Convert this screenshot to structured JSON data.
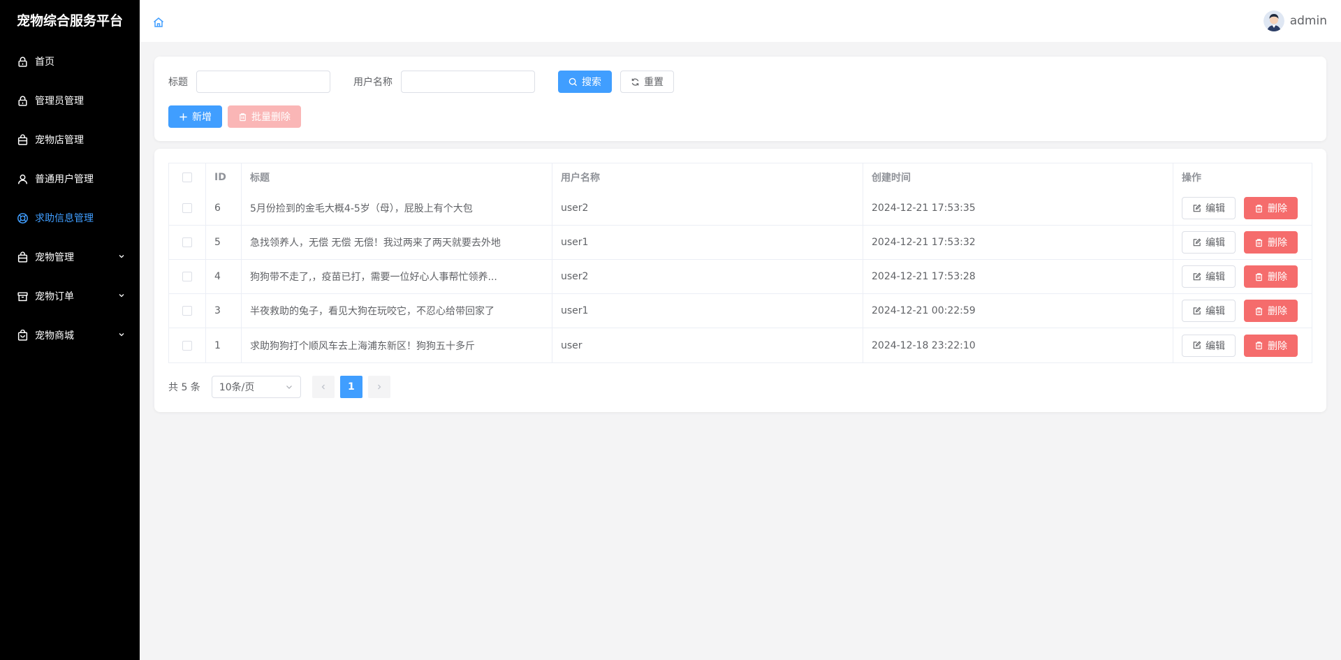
{
  "sidebar": {
    "title": "宠物综合服务平台",
    "items": [
      {
        "label": "首页",
        "icon": "lock-icon"
      },
      {
        "label": "管理员管理",
        "icon": "lock-icon"
      },
      {
        "label": "宠物店管理",
        "icon": "bag-icon"
      },
      {
        "label": "普通用户管理",
        "icon": "user-icon"
      },
      {
        "label": "求助信息管理",
        "icon": "help-icon",
        "active": true
      },
      {
        "label": "宠物管理",
        "icon": "bag-icon",
        "expandable": true
      },
      {
        "label": "宠物订单",
        "icon": "box-icon",
        "expandable": true
      },
      {
        "label": "宠物商城",
        "icon": "shop-icon",
        "expandable": true
      }
    ]
  },
  "header": {
    "username": "admin"
  },
  "search": {
    "title_label": "标题",
    "title_value": "",
    "username_label": "用户名称",
    "username_value": "",
    "search_btn": "搜索",
    "reset_btn": "重置",
    "add_btn": "新增",
    "batch_delete_btn": "批量删除"
  },
  "table": {
    "columns": [
      "ID",
      "标题",
      "用户名称",
      "创建时间",
      "操作"
    ],
    "rows": [
      {
        "id": "6",
        "title": "5月份捡到的金毛大概4-5岁（母），屁股上有个大包",
        "user": "user2",
        "time": "2024-12-21 17:53:35"
      },
      {
        "id": "5",
        "title": "急找领养人，无偿 无偿 无偿！我过两来了两天就要去外地",
        "user": "user1",
        "time": "2024-12-21 17:53:32"
      },
      {
        "id": "4",
        "title": "狗狗带不走了,，疫苗已打，需要一位好心人事帮忙领养...",
        "user": "user2",
        "time": "2024-12-21 17:53:28"
      },
      {
        "id": "3",
        "title": "半夜救助的兔子，看见大狗在玩咬它，不忍心给带回家了",
        "user": "user1",
        "time": "2024-12-21 00:22:59"
      },
      {
        "id": "1",
        "title": "求助狗狗打个顺风车去上海浦东新区！狗狗五十多斤",
        "user": "user",
        "time": "2024-12-18 23:22:10"
      }
    ],
    "edit_btn": "编辑",
    "delete_btn": "删除"
  },
  "pagination": {
    "total": "共 5 条",
    "page_size": "10条/页",
    "current_page": "1"
  },
  "colors": {
    "primary": "#409eff",
    "danger": "#f56c6c",
    "danger_light": "#fab6b6",
    "sidebar_bg": "#000000"
  }
}
